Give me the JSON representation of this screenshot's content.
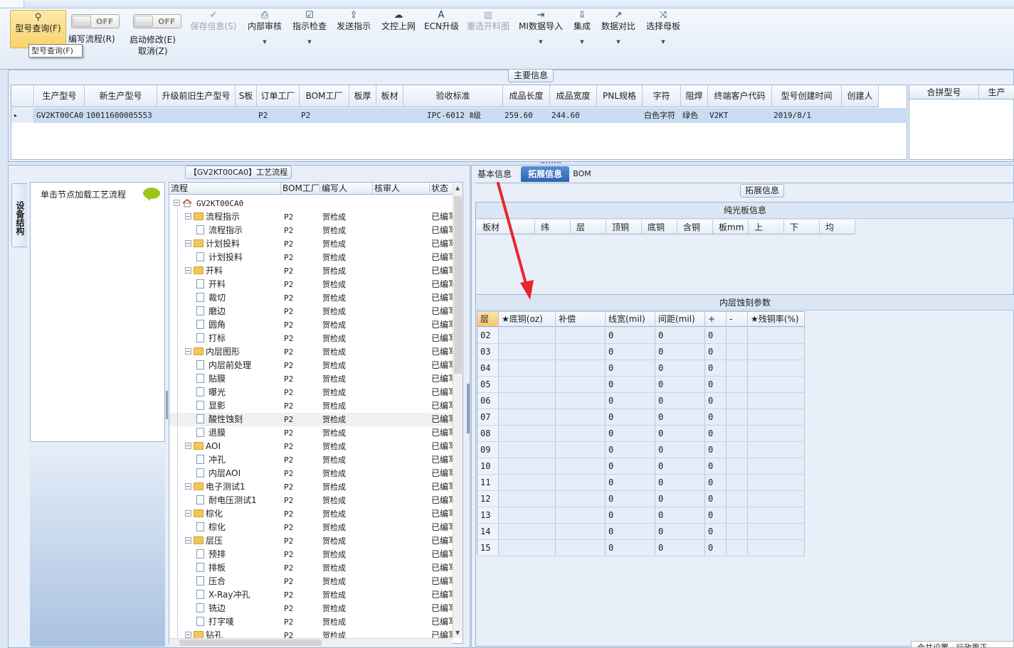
{
  "ribbon": {
    "query_btn": "型号查询(F)",
    "tooltip": "型号查询(F)",
    "toggle1": "OFF",
    "toggle2": "OFF",
    "edit_flow": "编写流程(R)",
    "enable_edit": "启动修改(E)",
    "cancel": "取消(Z)",
    "buttons": [
      {
        "label": "保存信息(S)",
        "icon": "✔"
      },
      {
        "label": "内部审核",
        "icon": "⎙"
      },
      {
        "label": "指示检查",
        "icon": "☑"
      },
      {
        "label": "发送指示",
        "icon": "⇪"
      },
      {
        "label": "文控上网",
        "icon": "☁"
      },
      {
        "label": "ECN升级",
        "icon": "A"
      },
      {
        "label": "重选开料图",
        "icon": "▨"
      },
      {
        "label": "MI数据导入",
        "icon": "⇥"
      },
      {
        "label": "集成",
        "icon": "⇩"
      },
      {
        "label": "数据对比",
        "icon": "↗"
      },
      {
        "label": "选择母板",
        "icon": "⤨"
      }
    ]
  },
  "main_info": {
    "section_title": "主要信息",
    "columns": [
      "生产型号",
      "新生产型号",
      "升级前旧生产型号",
      "S板",
      "订单工厂",
      "BOM工厂",
      "板厚",
      "板材",
      "验收标准",
      "成品长度",
      "成品宽度",
      "PNL规格",
      "字符",
      "阻焊",
      "终端客户代码",
      "型号创建时间",
      "创建人"
    ],
    "row": [
      "GV2KT00CA0",
      "10011600005553",
      "",
      "",
      "P2",
      "P2",
      "",
      "",
      "IPC-6012 Ⅱ级",
      "259.60",
      "244.60",
      "",
      "白色字符",
      "绿色",
      "V2KT",
      "2019/8/1",
      ""
    ],
    "row_marker": "▸",
    "combine_columns": [
      "合拼型号",
      "生产"
    ]
  },
  "process": {
    "title": "【GV2KT00CA0】工艺流程",
    "side_tab": "设备结构",
    "node_hint": "单击节点加载工艺流程",
    "columns": [
      "流程",
      "BOM工厂",
      "编写人",
      "核审人",
      "状态"
    ],
    "root": "GV2KT00CA0",
    "rows": [
      {
        "lvl": 1,
        "type": "folder",
        "name": "流程指示",
        "fac": "P2",
        "who": "贺检成",
        "chk": "",
        "st": "已编写"
      },
      {
        "lvl": 2,
        "type": "page",
        "name": "流程指示",
        "fac": "P2",
        "who": "贺检成",
        "chk": "",
        "st": "已编写"
      },
      {
        "lvl": 1,
        "type": "folder",
        "name": "计划投料",
        "fac": "P2",
        "who": "贺检成",
        "chk": "",
        "st": "已编写"
      },
      {
        "lvl": 2,
        "type": "page",
        "name": "计划投料",
        "fac": "P2",
        "who": "贺检成",
        "chk": "",
        "st": "已编写"
      },
      {
        "lvl": 1,
        "type": "folder",
        "name": "开料",
        "fac": "P2",
        "who": "贺检成",
        "chk": "",
        "st": "已编写"
      },
      {
        "lvl": 2,
        "type": "page",
        "name": "开料",
        "fac": "P2",
        "who": "贺检成",
        "chk": "",
        "st": "已编写"
      },
      {
        "lvl": 2,
        "type": "page",
        "name": "裁切",
        "fac": "P2",
        "who": "贺检成",
        "chk": "",
        "st": "已编写"
      },
      {
        "lvl": 2,
        "type": "page",
        "name": "磨边",
        "fac": "P2",
        "who": "贺检成",
        "chk": "",
        "st": "已编写"
      },
      {
        "lvl": 2,
        "type": "page",
        "name": "圆角",
        "fac": "P2",
        "who": "贺检成",
        "chk": "",
        "st": "已编写"
      },
      {
        "lvl": 2,
        "type": "page",
        "name": "打标",
        "fac": "P2",
        "who": "贺检成",
        "chk": "",
        "st": "已编写"
      },
      {
        "lvl": 1,
        "type": "folder",
        "name": "内层图形",
        "fac": "P2",
        "who": "贺检成",
        "chk": "",
        "st": "已编写"
      },
      {
        "lvl": 2,
        "type": "page",
        "name": "内层前处理",
        "fac": "P2",
        "who": "贺检成",
        "chk": "",
        "st": "已编写"
      },
      {
        "lvl": 2,
        "type": "page",
        "name": "贴膜",
        "fac": "P2",
        "who": "贺检成",
        "chk": "",
        "st": "已编写"
      },
      {
        "lvl": 2,
        "type": "page",
        "name": "曝光",
        "fac": "P2",
        "who": "贺检成",
        "chk": "",
        "st": "已编写"
      },
      {
        "lvl": 2,
        "type": "page",
        "name": "显影",
        "fac": "P2",
        "who": "贺检成",
        "chk": "",
        "st": "已编写"
      },
      {
        "lvl": 2,
        "type": "page",
        "name": "酸性蚀刻",
        "fac": "P2",
        "who": "贺检成",
        "chk": "",
        "st": "已编写",
        "sel": true
      },
      {
        "lvl": 2,
        "type": "page",
        "name": "退膜",
        "fac": "P2",
        "who": "贺检成",
        "chk": "",
        "st": "已编写"
      },
      {
        "lvl": 1,
        "type": "folder",
        "name": "AOI",
        "fac": "P2",
        "who": "贺检成",
        "chk": "",
        "st": "已编写"
      },
      {
        "lvl": 2,
        "type": "page",
        "name": "冲孔",
        "fac": "P2",
        "who": "贺检成",
        "chk": "",
        "st": "已编写"
      },
      {
        "lvl": 2,
        "type": "page",
        "name": "内层AOI",
        "fac": "P2",
        "who": "贺检成",
        "chk": "",
        "st": "已编写"
      },
      {
        "lvl": 1,
        "type": "folder",
        "name": "电子测试1",
        "fac": "P2",
        "who": "贺检成",
        "chk": "",
        "st": "已编写"
      },
      {
        "lvl": 2,
        "type": "page",
        "name": "耐电压测试1",
        "fac": "P2",
        "who": "贺检成",
        "chk": "",
        "st": "已编写"
      },
      {
        "lvl": 1,
        "type": "folder",
        "name": "棕化",
        "fac": "P2",
        "who": "贺检成",
        "chk": "",
        "st": "已编写"
      },
      {
        "lvl": 2,
        "type": "page",
        "name": "棕化",
        "fac": "P2",
        "who": "贺检成",
        "chk": "",
        "st": "已编写"
      },
      {
        "lvl": 1,
        "type": "folder",
        "name": "层压",
        "fac": "P2",
        "who": "贺检成",
        "chk": "",
        "st": "已编写"
      },
      {
        "lvl": 2,
        "type": "page",
        "name": "预排",
        "fac": "P2",
        "who": "贺检成",
        "chk": "",
        "st": "已编写"
      },
      {
        "lvl": 2,
        "type": "page",
        "name": "排板",
        "fac": "P2",
        "who": "贺检成",
        "chk": "",
        "st": "已编写"
      },
      {
        "lvl": 2,
        "type": "page",
        "name": "压合",
        "fac": "P2",
        "who": "贺检成",
        "chk": "",
        "st": "已编写"
      },
      {
        "lvl": 2,
        "type": "page",
        "name": "X-Ray冲孔",
        "fac": "P2",
        "who": "贺检成",
        "chk": "",
        "st": "已编写"
      },
      {
        "lvl": 2,
        "type": "page",
        "name": "铣边",
        "fac": "P2",
        "who": "贺检成",
        "chk": "",
        "st": "已编写"
      },
      {
        "lvl": 2,
        "type": "page",
        "name": "打字唛",
        "fac": "P2",
        "who": "贺检成",
        "chk": "",
        "st": "已编写"
      },
      {
        "lvl": 1,
        "type": "folder",
        "name": "钻孔",
        "fac": "P2",
        "who": "贺检成",
        "chk": "",
        "st": "已编写"
      }
    ]
  },
  "right": {
    "tabs": [
      "基本信息",
      "拓展信息",
      "BOM"
    ],
    "active_tab": 1,
    "section_title": "拓展信息",
    "guang_title": "纯光板信息",
    "guang_columns": [
      "板材",
      "纬",
      "层",
      "顶铜",
      "底铜",
      "含铜",
      "板mm",
      "上",
      "下",
      "均"
    ],
    "etch_title": "内层蚀刻参数",
    "etch_columns": [
      "层",
      "★底铜(oz)",
      "补偿",
      "线宽(mil)",
      "间距(mil)",
      "+",
      "-",
      "★残铜率(%)"
    ],
    "etch_rows": [
      [
        "02",
        "",
        "",
        "0",
        "0",
        "0",
        "",
        ""
      ],
      [
        "03",
        "",
        "",
        "0",
        "0",
        "0",
        "",
        ""
      ],
      [
        "04",
        "",
        "",
        "0",
        "0",
        "0",
        "",
        ""
      ],
      [
        "05",
        "",
        "",
        "0",
        "0",
        "0",
        "",
        ""
      ],
      [
        "06",
        "",
        "",
        "0",
        "0",
        "0",
        "",
        ""
      ],
      [
        "07",
        "",
        "",
        "0",
        "0",
        "0",
        "",
        ""
      ],
      [
        "08",
        "",
        "",
        "0",
        "0",
        "0",
        "",
        ""
      ],
      [
        "09",
        "",
        "",
        "0",
        "0",
        "0",
        "",
        ""
      ],
      [
        "10",
        "",
        "",
        "0",
        "0",
        "0",
        "",
        ""
      ],
      [
        "11",
        "",
        "",
        "0",
        "0",
        "0",
        "",
        ""
      ],
      [
        "12",
        "",
        "",
        "0",
        "0",
        "0",
        "",
        ""
      ],
      [
        "13",
        "",
        "",
        "0",
        "0",
        "0",
        "",
        ""
      ],
      [
        "14",
        "",
        "",
        "0",
        "0",
        "0",
        "",
        ""
      ],
      [
        "15",
        "",
        "",
        "0",
        "0",
        "0",
        "",
        ""
      ]
    ],
    "bottom_tab": "合并设置 · 行政更正"
  },
  "colors": {
    "annotation_arrow": "#e8262b",
    "selection_row": "#c9dcf4",
    "active_tab": "#2b64b4"
  }
}
